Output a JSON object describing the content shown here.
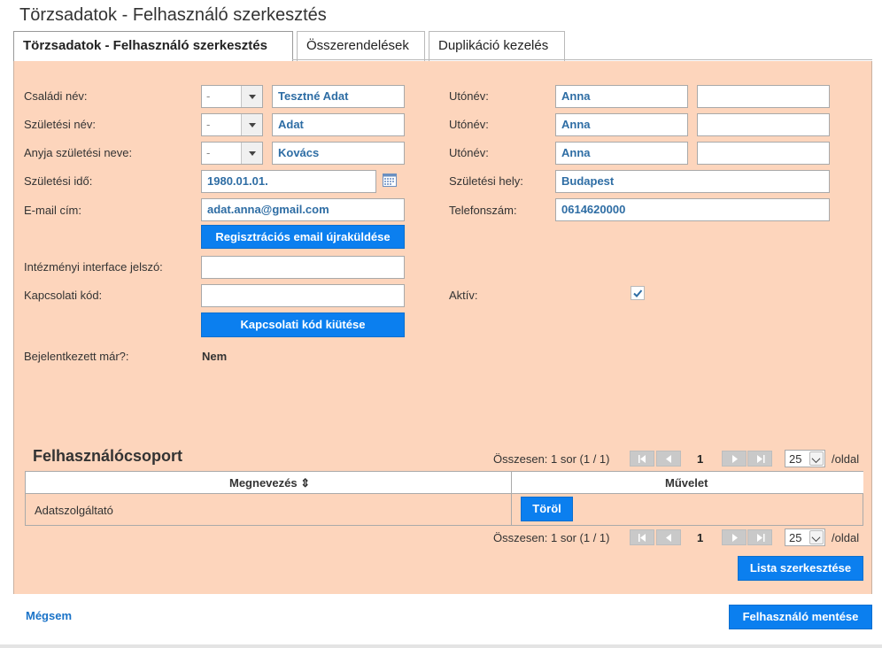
{
  "page": {
    "title": "Törzsadatok - Felhasználó szerkesztés"
  },
  "tabs": [
    {
      "label": "Törzsadatok - Felhasználó szerkesztés",
      "active": true
    },
    {
      "label": "Összerendelések",
      "active": false
    },
    {
      "label": "Duplikáció kezelés",
      "active": false
    }
  ],
  "form": {
    "family_name": {
      "label": "Családi név:",
      "prefix": "-",
      "value": "Tesztné Adat"
    },
    "birth_name": {
      "label": "Születési név:",
      "prefix": "-",
      "value": "Adat"
    },
    "mother_name": {
      "label": "Anyja születési neve:",
      "prefix": "-",
      "value": "Kovács"
    },
    "given_names": [
      {
        "label": "Utónév:",
        "value1": "Anna",
        "value2": ""
      },
      {
        "label": "Utónév:",
        "value1": "Anna",
        "value2": ""
      },
      {
        "label": "Utónév:",
        "value1": "Anna",
        "value2": ""
      }
    ],
    "birth_date": {
      "label": "Születési idő:",
      "value": "1980.01.01."
    },
    "birth_place": {
      "label": "Születési hely:",
      "value": "Budapest"
    },
    "email": {
      "label": "E-mail cím:",
      "value": "adat.anna@gmail.com"
    },
    "phone": {
      "label": "Telefonszám:",
      "value": "0614620000"
    },
    "resend_email_button": "Regisztrációs email újraküldése",
    "interface_password": {
      "label": "Intézményi interface jelszó:",
      "value": ""
    },
    "connection_code": {
      "label": "Kapcsolati kód:",
      "value": ""
    },
    "active": {
      "label": "Aktív:",
      "checked": true
    },
    "generate_code_button": "Kapcsolati kód kiütése",
    "logged_in": {
      "label": "Bejelentkezett már?:",
      "value": "Nem"
    }
  },
  "group": {
    "title": "Felhasználócsoport",
    "summary": "Összesen: 1 sor (1 / 1)",
    "page": "1",
    "per_page": "25",
    "per_page_suffix": "/oldal",
    "columns": {
      "name": "Megnevezés ⇕",
      "action": "Művelet"
    },
    "rows": [
      {
        "name": "Adatszolgáltató",
        "action": "Töröl"
      }
    ],
    "edit_list_button": "Lista szerkesztése"
  },
  "footer": {
    "cancel": "Mégsem",
    "save": "Felhasználó mentése"
  },
  "colors": {
    "panel": "#fdd5bc",
    "accent": "#0b7fef",
    "value_text": "#2e6da4"
  }
}
